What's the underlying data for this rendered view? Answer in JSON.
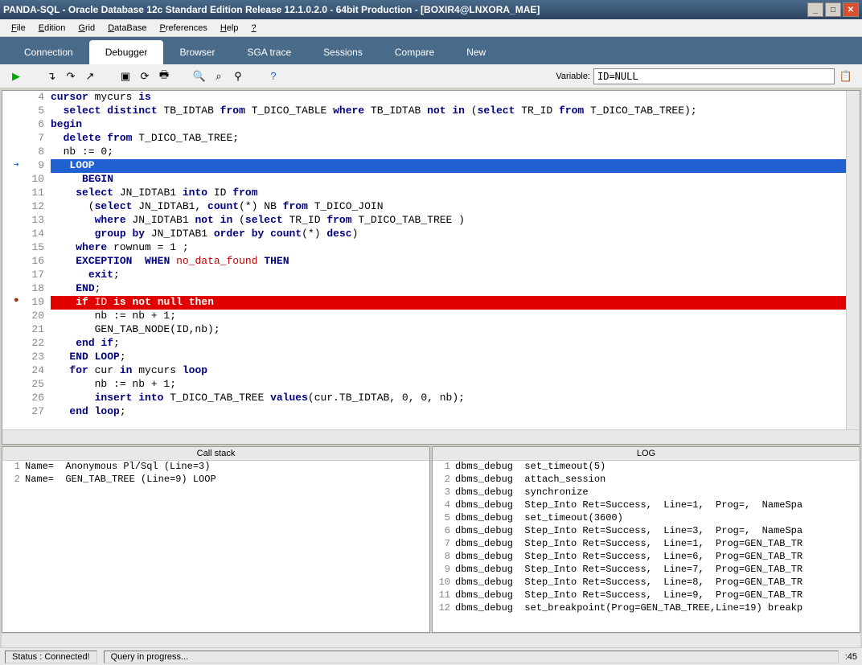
{
  "title": "PANDA-SQL - Oracle Database 12c Standard Edition Release 12.1.0.2.0 - 64bit Production - [BOXIR4@LNXORA_MAE]",
  "menu": [
    "File",
    "Edition",
    "Grid",
    "DataBase",
    "Preferences",
    "Help",
    "?"
  ],
  "tabs": [
    "Connection",
    "Debugger",
    "Browser",
    "SGA trace",
    "Sessions",
    "Compare",
    "New"
  ],
  "active_tab": "Debugger",
  "variable_label": "Variable:",
  "variable_value": "ID=NULL",
  "code": [
    {
      "n": 4,
      "raw": "cursor mycurs is",
      "tokens": [
        [
          "kw",
          "cursor"
        ],
        [
          "",
          ", mycurs "
        ],
        [
          "kw",
          "is"
        ]
      ]
    },
    {
      "n": 5,
      "raw": "  select distinct TB_IDTAB from T_DICO_TABLE where TB_IDTAB not in (select TR_ID from T_DICO_TAB_TREE);",
      "tokens": [
        [
          "",
          "  "
        ],
        [
          "kw",
          "select"
        ],
        [
          "",
          ", "
        ],
        [
          "kw",
          "distinct"
        ],
        [
          "",
          ", TB_IDTAB "
        ],
        [
          "kw",
          "from"
        ],
        [
          "",
          ", T_DICO_TABLE "
        ],
        [
          "kw",
          "where"
        ],
        [
          "",
          ", TB_IDTAB "
        ],
        [
          "kw",
          "not"
        ],
        [
          "",
          ", "
        ],
        [
          "kw",
          "in"
        ],
        [
          "",
          ", ("
        ],
        [
          "kw",
          "select"
        ],
        [
          "",
          ", TR_ID "
        ],
        [
          "kw",
          "from"
        ],
        [
          "",
          ", T_DICO_TAB_TREE);"
        ]
      ]
    },
    {
      "n": 6,
      "raw": "begin",
      "tokens": [
        [
          "kw",
          "begin"
        ]
      ]
    },
    {
      "n": 7,
      "raw": "  delete from T_DICO_TAB_TREE;",
      "tokens": [
        [
          "",
          "  "
        ],
        [
          "kw",
          "delete"
        ],
        [
          "",
          ", "
        ],
        [
          "kw",
          "from"
        ],
        [
          "",
          ", T_DICO_TAB_TREE;"
        ]
      ]
    },
    {
      "n": 8,
      "raw": "  nb := 0;",
      "tokens": [
        [
          "",
          "  nb := 0;"
        ]
      ]
    },
    {
      "n": 9,
      "raw": "   LOOP",
      "cls": "current",
      "marker": "arrow",
      "tokens": [
        [
          "",
          "   "
        ],
        [
          "kw",
          "LOOP"
        ]
      ]
    },
    {
      "n": 10,
      "raw": "     BEGIN",
      "tokens": [
        [
          "",
          "     "
        ],
        [
          "kw",
          "BEGIN"
        ]
      ]
    },
    {
      "n": 11,
      "raw": "    select JN_IDTAB1 into ID from",
      "tokens": [
        [
          "",
          "    "
        ],
        [
          "kw",
          "select"
        ],
        [
          "",
          ", JN_IDTAB1 "
        ],
        [
          "kw",
          "into"
        ],
        [
          "",
          ", ID "
        ],
        [
          "kw",
          "from"
        ]
      ]
    },
    {
      "n": 12,
      "raw": "      (select JN_IDTAB1, count(*) NB from T_DICO_JOIN",
      "tokens": [
        [
          "",
          "      ("
        ],
        [
          "kw",
          "select"
        ],
        [
          "",
          ", JN_IDTAB1, "
        ],
        [
          "kw",
          "count"
        ],
        [
          "",
          "(*) NB "
        ],
        [
          "kw",
          "from"
        ],
        [
          "",
          ", T_DICO_JOIN"
        ]
      ]
    },
    {
      "n": 13,
      "raw": "       where JN_IDTAB1 not in (select TR_ID from T_DICO_TAB_TREE )",
      "tokens": [
        [
          "",
          "       "
        ],
        [
          "kw",
          "where"
        ],
        [
          "",
          ", JN_IDTAB1 "
        ],
        [
          "kw",
          "not"
        ],
        [
          "",
          ", "
        ],
        [
          "kw",
          "in"
        ],
        [
          "",
          ", ("
        ],
        [
          "kw",
          "select"
        ],
        [
          "",
          ", TR_ID "
        ],
        [
          "kw",
          "from"
        ],
        [
          "",
          ", T_DICO_TAB_TREE )"
        ]
      ]
    },
    {
      "n": 14,
      "raw": "       group by JN_IDTAB1 order by count(*) desc)",
      "tokens": [
        [
          "",
          "       "
        ],
        [
          "kw",
          "group"
        ],
        [
          "",
          ", "
        ],
        [
          "kw",
          "by"
        ],
        [
          "",
          ", JN_IDTAB1 "
        ],
        [
          "kw",
          "order"
        ],
        [
          "",
          ", "
        ],
        [
          "kw",
          "by"
        ],
        [
          "",
          ", "
        ],
        [
          "kw",
          "count"
        ],
        [
          "",
          "(*) "
        ],
        [
          "kw",
          "desc"
        ],
        [
          "",
          ")"
        ]
      ]
    },
    {
      "n": 15,
      "raw": "    where rownum = 1 ;",
      "tokens": [
        [
          "",
          "    "
        ],
        [
          "kw",
          "where"
        ],
        [
          "",
          ", rownum = 1 ;"
        ]
      ]
    },
    {
      "n": 16,
      "raw": "    EXCEPTION  WHEN no_data_found THEN",
      "tokens": [
        [
          "",
          "    "
        ],
        [
          "kw",
          "EXCEPTION"
        ],
        [
          "",
          "  "
        ],
        [
          "kw",
          "WHEN"
        ],
        [
          "",
          ", "
        ],
        [
          "op",
          "no_data_found"
        ],
        [
          "",
          ", "
        ],
        [
          "kw",
          "THEN"
        ]
      ]
    },
    {
      "n": 17,
      "raw": "      exit;",
      "tokens": [
        [
          "",
          "      "
        ],
        [
          "kw",
          "exit"
        ],
        [
          "",
          ";"
        ]
      ]
    },
    {
      "n": 18,
      "raw": "    END;",
      "tokens": [
        [
          "",
          "    "
        ],
        [
          "kw",
          "END"
        ],
        [
          "",
          ";"
        ]
      ]
    },
    {
      "n": 19,
      "raw": "    if ID is not null then",
      "cls": "bp",
      "marker": "bp",
      "tokens": [
        [
          "",
          "    "
        ],
        [
          "kw",
          "if"
        ],
        [
          "",
          ", ID "
        ],
        [
          "kw",
          "is"
        ],
        [
          "",
          ", "
        ],
        [
          "kw",
          "not"
        ],
        [
          "",
          ", "
        ],
        [
          "kw",
          "null"
        ],
        [
          "",
          ", "
        ],
        [
          "kw",
          "then"
        ]
      ]
    },
    {
      "n": 20,
      "raw": "       nb := nb + 1;",
      "tokens": [
        [
          "",
          "       nb := nb + 1;"
        ]
      ]
    },
    {
      "n": 21,
      "raw": "       GEN_TAB_NODE(ID,nb);",
      "tokens": [
        [
          "",
          "       GEN_TAB_NODE(ID,nb);"
        ]
      ]
    },
    {
      "n": 22,
      "raw": "    end if;",
      "tokens": [
        [
          "",
          "    "
        ],
        [
          "kw",
          "end"
        ],
        [
          "",
          ", "
        ],
        [
          "kw",
          "if"
        ],
        [
          "",
          ";"
        ]
      ]
    },
    {
      "n": 23,
      "raw": "   END LOOP;",
      "tokens": [
        [
          "",
          "   "
        ],
        [
          "kw",
          "END"
        ],
        [
          "",
          ", "
        ],
        [
          "kw",
          "LOOP"
        ],
        [
          "",
          ";"
        ]
      ]
    },
    {
      "n": 24,
      "raw": "   for cur in mycurs loop",
      "tokens": [
        [
          "",
          "   "
        ],
        [
          "kw",
          "for"
        ],
        [
          "",
          ", cur "
        ],
        [
          "kw",
          "in"
        ],
        [
          "",
          ", mycurs "
        ],
        [
          "kw",
          "loop"
        ]
      ]
    },
    {
      "n": 25,
      "raw": "       nb := nb + 1;",
      "tokens": [
        [
          "",
          "       nb := nb + 1;"
        ]
      ]
    },
    {
      "n": 26,
      "raw": "       insert into T_DICO_TAB_TREE values(cur.TB_IDTAB, 0, 0, nb);",
      "tokens": [
        [
          "",
          "       "
        ],
        [
          "kw",
          "insert"
        ],
        [
          "",
          ", "
        ],
        [
          "kw",
          "into"
        ],
        [
          "",
          ", T_DICO_TAB_TREE "
        ],
        [
          "kw",
          "values"
        ],
        [
          "",
          "(cur.TB_IDTAB, 0, 0, nb);"
        ]
      ]
    },
    {
      "n": 27,
      "raw": "   end loop;",
      "tokens": [
        [
          "",
          "   "
        ],
        [
          "kw",
          "end"
        ],
        [
          "",
          ", "
        ],
        [
          "kw",
          "loop"
        ],
        [
          "",
          ";"
        ]
      ]
    }
  ],
  "callstack_header": "Call stack",
  "callstack": [
    {
      "n": 1,
      "text": "Name=  Anonymous Pl/Sql (Line=3)"
    },
    {
      "n": 2,
      "text": "Name=  GEN_TAB_TREE (Line=9) LOOP"
    }
  ],
  "log_header": "LOG",
  "log": [
    {
      "n": 1,
      "text": "dbms_debug  set_timeout(5)"
    },
    {
      "n": 2,
      "text": "dbms_debug  attach_session"
    },
    {
      "n": 3,
      "text": "dbms_debug  synchronize"
    },
    {
      "n": 4,
      "text": "dbms_debug  Step_Into Ret=Success,  Line=1,  Prog=,  NameSpa"
    },
    {
      "n": 5,
      "text": "dbms_debug  set_timeout(3600)"
    },
    {
      "n": 6,
      "text": "dbms_debug  Step_Into Ret=Success,  Line=3,  Prog=,  NameSpa"
    },
    {
      "n": 7,
      "text": "dbms_debug  Step_Into Ret=Success,  Line=1,  Prog=GEN_TAB_TR"
    },
    {
      "n": 8,
      "text": "dbms_debug  Step_Into Ret=Success,  Line=6,  Prog=GEN_TAB_TR"
    },
    {
      "n": 9,
      "text": "dbms_debug  Step_Into Ret=Success,  Line=7,  Prog=GEN_TAB_TR"
    },
    {
      "n": 10,
      "text": "dbms_debug  Step_Into Ret=Success,  Line=8,  Prog=GEN_TAB_TR"
    },
    {
      "n": 11,
      "text": "dbms_debug  Step_Into Ret=Success,  Line=9,  Prog=GEN_TAB_TR"
    },
    {
      "n": 12,
      "text": "dbms_debug  set_breakpoint(Prog=GEN_TAB_TREE,Line=19) breakp"
    }
  ],
  "status": {
    "conn": "Status : Connected!",
    "query": "Query in progress...",
    "time": ":45"
  }
}
